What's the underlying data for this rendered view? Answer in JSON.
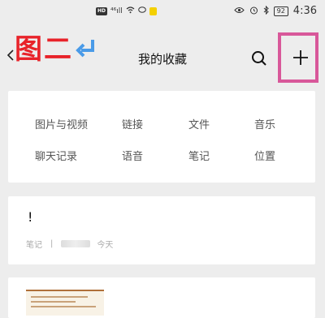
{
  "status_bar": {
    "hd": "HD",
    "signal": "⁴⁶ıll",
    "battery": "92",
    "time": "4:36"
  },
  "annotation": {
    "text": "图二"
  },
  "header": {
    "title": "我的收藏"
  },
  "categories": [
    {
      "label": "图片与视频"
    },
    {
      "label": "链接"
    },
    {
      "label": "文件"
    },
    {
      "label": "音乐"
    },
    {
      "label": "聊天记录"
    },
    {
      "label": "语音"
    },
    {
      "label": "笔记"
    },
    {
      "label": "位置"
    }
  ],
  "note": {
    "title": "!",
    "type": "笔记",
    "separator": "|",
    "date": "今天"
  },
  "colors": {
    "accent_red": "#e8232a",
    "highlight_pink": "#d8589a"
  }
}
